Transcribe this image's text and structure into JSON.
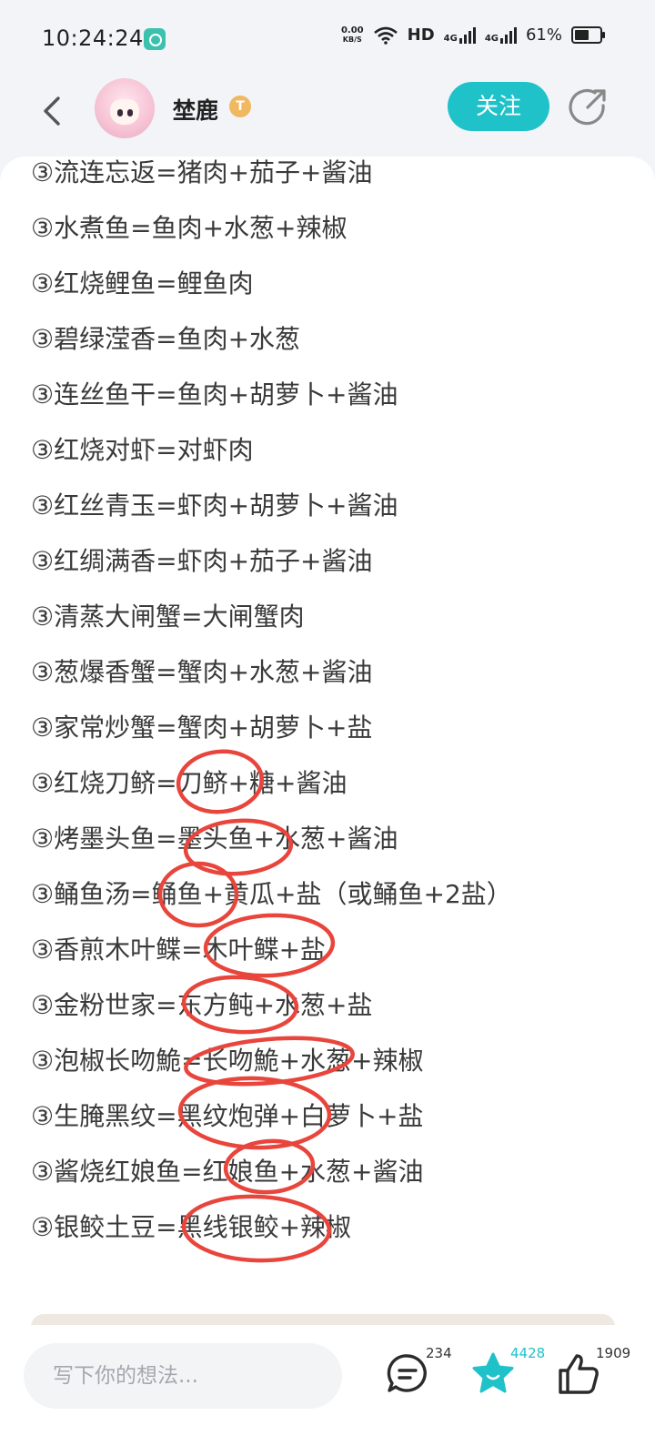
{
  "status_bar": {
    "time": "10:24:24",
    "net_speed_value": "0.00",
    "net_speed_unit": "KB/S",
    "hd": "HD",
    "net1": "4G",
    "net2": "4G",
    "battery": "61%"
  },
  "header": {
    "username": "埜鹿",
    "level_badge": "T",
    "follow_label": "关注"
  },
  "content": {
    "lines": [
      "③流连忘返=猪肉+茄子+酱油",
      "③水煮鱼=鱼肉+水葱+辣椒",
      "③红烧鲤鱼=鲤鱼肉",
      "③碧绿滢香=鱼肉+水葱",
      "③连丝鱼干=鱼肉+胡萝卜+酱油",
      "③红烧对虾=对虾肉",
      "③红丝青玉=虾肉+胡萝卜+酱油",
      "③红绸满香=虾肉+茄子+酱油",
      "③清蒸大闸蟹=大闸蟹肉",
      "③葱爆香蟹=蟹肉+水葱+酱油",
      "③家常炒蟹=蟹肉+胡萝卜+盐",
      "③红烧刀鲚=刀鲚+糖+酱油",
      "③烤墨头鱼=墨头鱼+水葱+酱油",
      "③鲬鱼汤=鲬鱼+黄瓜+盐（或鲬鱼+2盐）",
      "③香煎木叶鲽=木叶鲽+盐",
      "③金粉世家=东方鲀+水葱+盐",
      "③泡椒长吻鮠=长吻鮠+水葱+辣椒",
      "③生腌黑纹=黑纹炮弹+白萝卜+盐",
      "③酱烧红娘鱼=红娘鱼+水葱+酱油",
      "③银鲛土豆=黑线银鲛+辣椒"
    ],
    "annotation_color": "#e8453c"
  },
  "bottom_bar": {
    "input_placeholder": "写下你的想法...",
    "comment_count": "234",
    "favorite_count": "4428",
    "like_count": "1909",
    "accent": "#20c2c9"
  }
}
